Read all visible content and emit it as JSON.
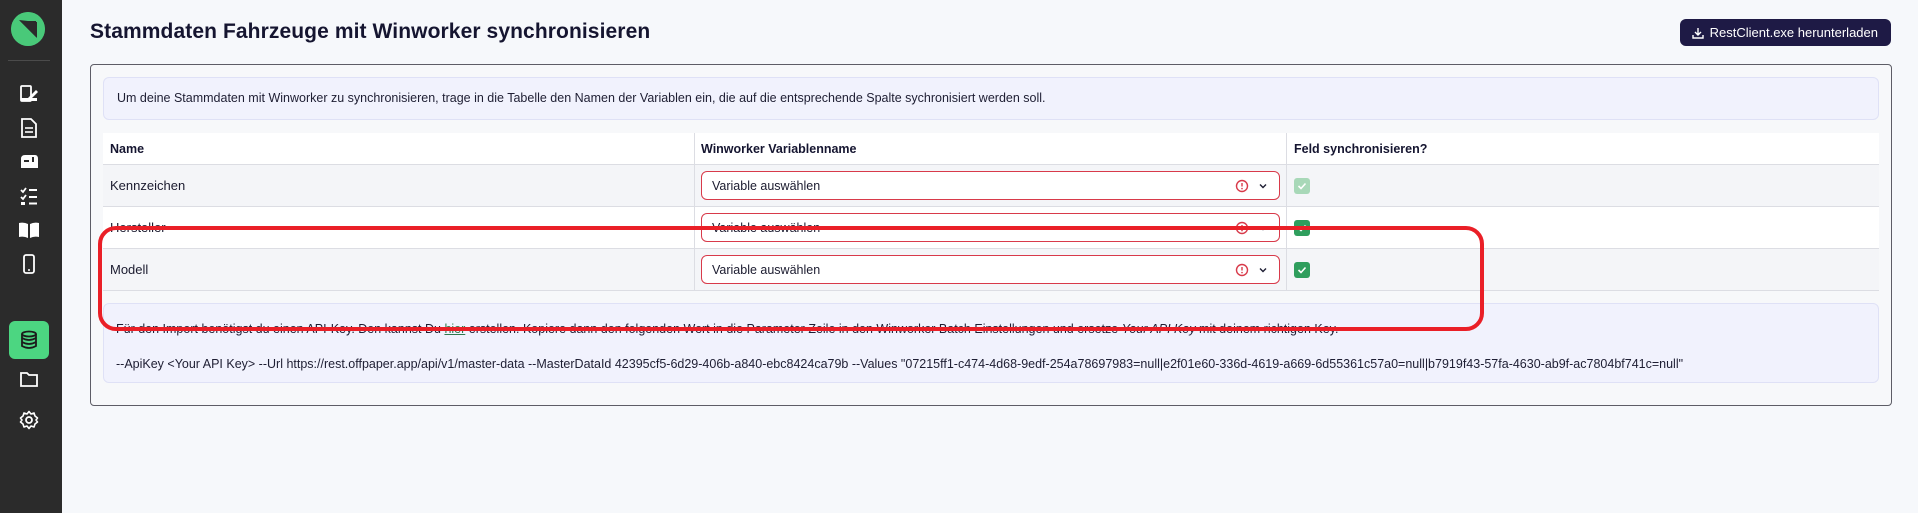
{
  "page": {
    "title": "Stammdaten Fahrzeuge mit Winworker synchronisieren",
    "download_label": "RestClient.exe herunterladen",
    "info_text": "Um deine Stammdaten mit Winworker zu synchronisieren, trage in die Tabelle den Namen der Variablen ein, die auf die entsprechende Spalte sychronisiert werden soll."
  },
  "sidebar": {
    "items": [
      {
        "icon": "edit-form-icon"
      },
      {
        "icon": "document-icon"
      },
      {
        "icon": "mailbox-icon"
      },
      {
        "icon": "checklist-icon"
      },
      {
        "icon": "book-icon"
      },
      {
        "icon": "mobile-icon"
      },
      {
        "icon": "database-icon",
        "active": true
      },
      {
        "icon": "folder-icon"
      },
      {
        "icon": "gear-icon"
      }
    ]
  },
  "table": {
    "headers": [
      "Name",
      "Winworker Variablenname",
      "Feld synchronisieren?"
    ],
    "rows": [
      {
        "name": "Kennzeichen",
        "variable": "Variable auswählen",
        "sync": "disabled"
      },
      {
        "name": "Hersteller",
        "variable": "Variable auswählen",
        "sync": "checked"
      },
      {
        "name": "Modell",
        "variable": "Variable auswählen",
        "sync": "checked"
      }
    ]
  },
  "import": {
    "line1_part1": "Für den Import benötigst du einen API-Key. Den kannst Du ",
    "link": "hier",
    "line1_part2": " erstellen. Kopiere dann den folgenden Wert in die Parameter Zeile in den Winworker Batch Einstellungen und ersetze ",
    "line1_em": "Your API Key",
    "line1_part3": " mit deinem richtigen Key.",
    "command": "--ApiKey <Your API Key> --Url https://rest.offpaper.app/api/v1/master-data --MasterDataId 42395cf5-6d29-406b-a840-ebc8424ca79b --Values \"07215ff1-c474-4d68-9edf-254a78697983=null|e2f01e60-336d-4619-a669-6d55361c57a0=null|b7919f43-57fa-4630-ab9f-ac7804bf741c=null\""
  },
  "colors": {
    "sidebar_bg": "#2b2b2b",
    "accent_green": "#4cd681",
    "button_dark": "#1e1a45",
    "error_red": "#d83a4a",
    "highlight_red": "#ea1f27"
  }
}
